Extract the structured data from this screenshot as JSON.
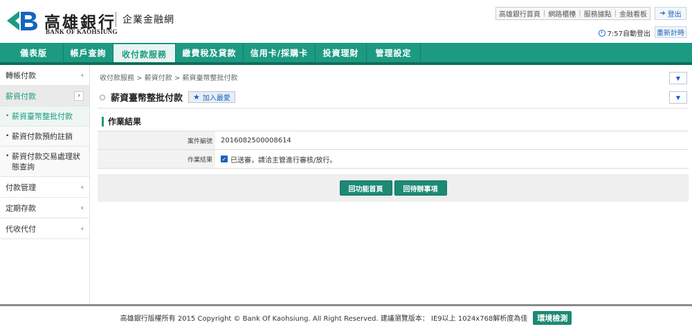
{
  "header": {
    "logo_cn": "高雄銀行",
    "logo_en": "BANK OF KAOHSIUNG",
    "site_name": "企業金融網",
    "top_links": [
      "高雄銀行首頁",
      "網路櫃檯",
      "服務據點",
      "金融看板"
    ],
    "logout_label": "登出",
    "session_text": "7:57自動登出",
    "renew_label": "重新計時"
  },
  "nav": {
    "items": [
      "儀表版",
      "帳戶查詢",
      "收付款服務",
      "繳費稅及貸款",
      "信用卡/採購卡",
      "投資理財",
      "管理設定"
    ],
    "active_index": 2
  },
  "sidebar": {
    "item_transfer": "轉帳付款",
    "item_salary": "薪資付款",
    "sub_items": [
      "薪資臺幣整批付款",
      "薪資付款預約註銷",
      "薪資付款交易處理狀態查詢"
    ],
    "item_payment_mgmt": "付款管理",
    "item_time_deposit": "定期存款",
    "item_collection": "代收代付"
  },
  "main": {
    "breadcrumb": "收付款服務 > 薪資付款 > 薪資臺幣整批付款",
    "page_title": "薪資臺幣整批付款",
    "fav_label": "加入最愛",
    "section_title": "作業結果",
    "rows": [
      {
        "label": "案件編號",
        "value": "2016082500008614"
      },
      {
        "label": "作業結果",
        "value": "已送審，請洽主管進行審核/放行。"
      }
    ],
    "btn_home": "回功能首頁",
    "btn_pending": "回待辦事項"
  },
  "footer": {
    "copyright": "高雄銀行版權所有 2015 Copyright © Bank Of Kaohsiung. All Right Reserved. 建議瀏覽版本： IE9以上 1024x768解析度為佳",
    "env_check": "環境檢測"
  },
  "colors": {
    "brand_green": "#1c9a82",
    "link_blue": "#1565c0"
  }
}
